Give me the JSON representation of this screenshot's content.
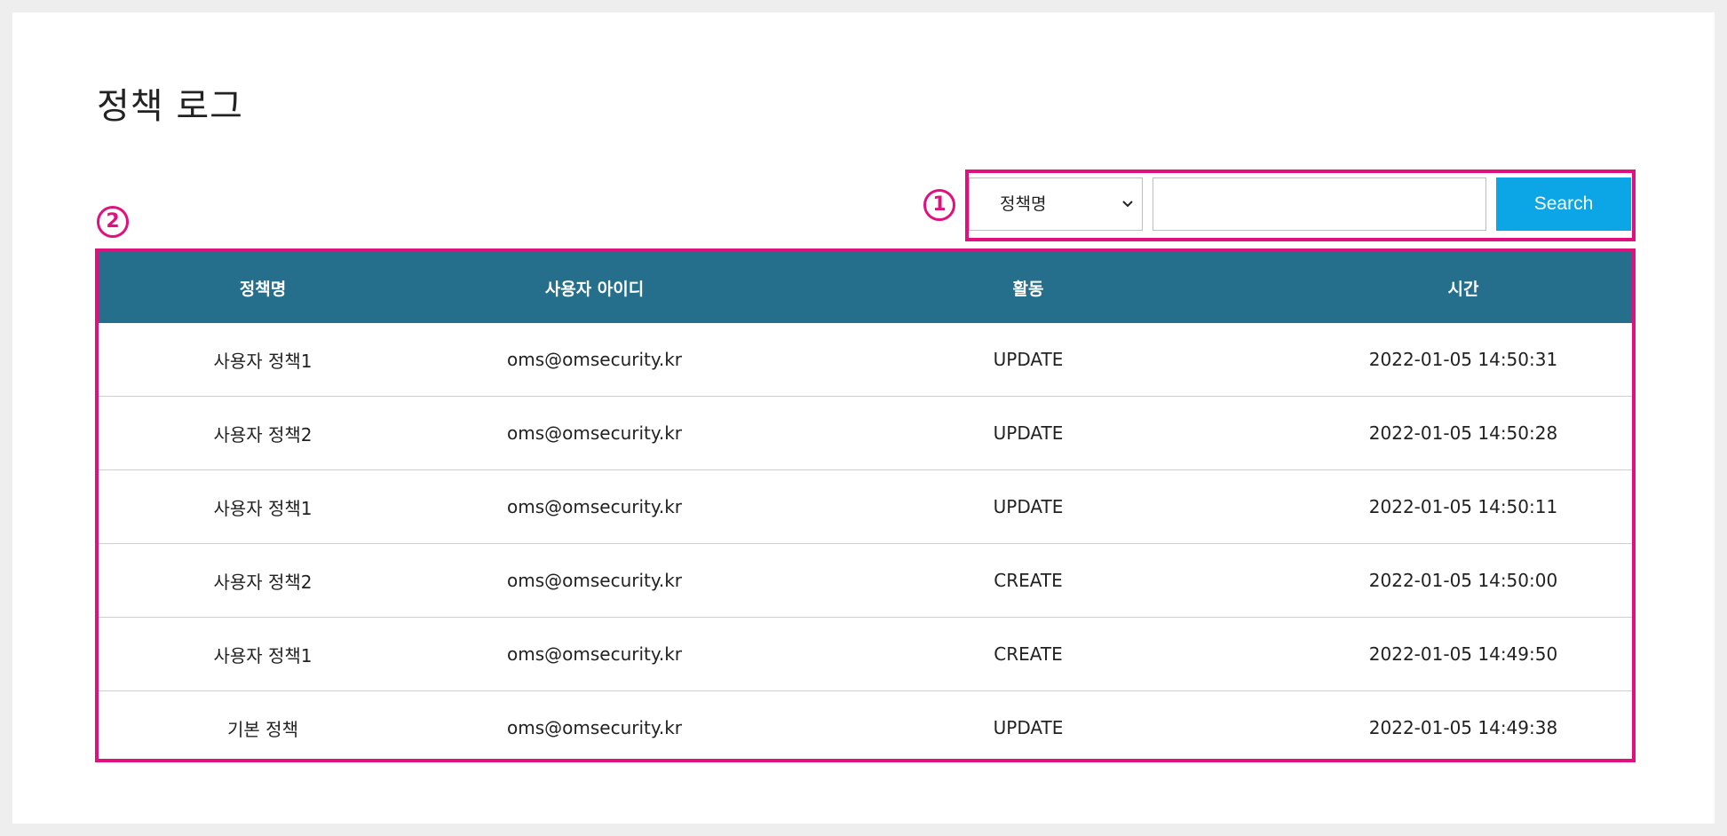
{
  "page": {
    "title": "정책 로그"
  },
  "markers": {
    "search_area": "1",
    "table_area": "2"
  },
  "search": {
    "field_selected": "정책명",
    "query_value": "",
    "button_label": "Search"
  },
  "table": {
    "columns": [
      "정책명",
      "사용자 아이디",
      "활동",
      "시간"
    ],
    "rows": [
      [
        "사용자 정책1",
        "oms@omsecurity.kr",
        "UPDATE",
        "2022-01-05 14:50:31"
      ],
      [
        "사용자 정책2",
        "oms@omsecurity.kr",
        "UPDATE",
        "2022-01-05 14:50:28"
      ],
      [
        "사용자 정책1",
        "oms@omsecurity.kr",
        "UPDATE",
        "2022-01-05 14:50:11"
      ],
      [
        "사용자 정책2",
        "oms@omsecurity.kr",
        "CREATE",
        "2022-01-05 14:50:00"
      ],
      [
        "사용자 정책1",
        "oms@omsecurity.kr",
        "CREATE",
        "2022-01-05 14:49:50"
      ],
      [
        "기본 정책",
        "oms@omsecurity.kr",
        "UPDATE",
        "2022-01-05 14:49:38"
      ]
    ]
  },
  "colors": {
    "header_bg": "#266f8c",
    "button_bg": "#0ca6e6",
    "highlight": "#e0117f"
  },
  "icons": {
    "select_arrow": "chevron-down-icon"
  }
}
